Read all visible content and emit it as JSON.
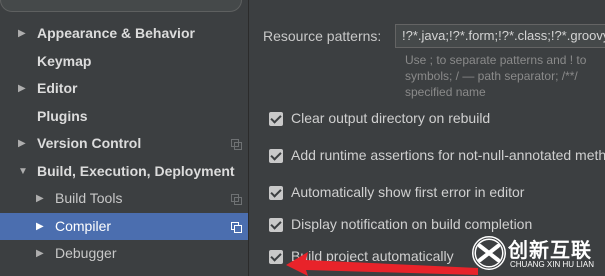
{
  "sidebar": {
    "items": [
      {
        "label": "Appearance & Behavior",
        "arrow": "▶"
      },
      {
        "label": "Keymap"
      },
      {
        "label": "Editor",
        "arrow": "▶"
      },
      {
        "label": "Plugins"
      },
      {
        "label": "Version Control",
        "arrow": "▶"
      },
      {
        "label": "Build, Execution, Deployment",
        "arrow": "▼"
      },
      {
        "label": "Build Tools",
        "arrow": "▶"
      },
      {
        "label": "Compiler",
        "arrow": "▶"
      },
      {
        "label": "Debugger",
        "arrow": "▶"
      }
    ]
  },
  "main": {
    "resource_patterns_label": "Resource patterns:",
    "resource_patterns_value": "!?*.java;!?*.form;!?*.class;!?*.groovy",
    "hint_lines": [
      "Use ; to separate patterns and ! to",
      "symbols; / — path separator; /**/",
      "specified name"
    ],
    "options": [
      {
        "label": "Clear output directory on rebuild",
        "checked": true
      },
      {
        "label": "Add runtime assertions for not-null-annotated methods",
        "checked": true
      },
      {
        "label": "Automatically show first error in editor",
        "checked": true
      },
      {
        "label": "Display notification on build completion",
        "checked": true
      },
      {
        "label": "Build project automatically",
        "checked": true
      }
    ]
  },
  "watermark": {
    "text": "创新互联",
    "subtext": "CHUANG XIN HU LIAN"
  },
  "colors": {
    "background": "#3c3f41",
    "selection": "#4b6eaf",
    "annotation_arrow": "#e8232a"
  }
}
